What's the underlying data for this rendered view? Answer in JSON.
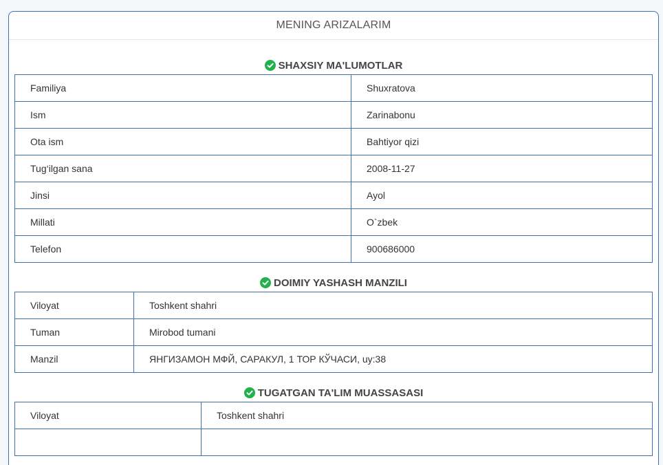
{
  "page": {
    "title": "MENING ARIZALARIM"
  },
  "sections": [
    {
      "title": "SHAXSIY MA'LUMOTLAR",
      "rows": [
        {
          "label": "Familiya",
          "value": "Shuxratova"
        },
        {
          "label": "Ism",
          "value": "Zarinabonu"
        },
        {
          "label": "Ota ism",
          "value": "Bahtiyor qizi"
        },
        {
          "label": "Tug‘ilgan sana",
          "value": "2008-11-27"
        },
        {
          "label": "Jinsi",
          "value": "Ayol"
        },
        {
          "label": "Millati",
          "value": "O`zbek"
        },
        {
          "label": "Telefon",
          "value": "900686000"
        }
      ]
    },
    {
      "title": "DOIMIY YASHASH MANZILI",
      "rows": [
        {
          "label": "Viloyat",
          "value": "Toshkent shahri"
        },
        {
          "label": "Tuman",
          "value": "Mirobod tumani"
        },
        {
          "label": "Manzil",
          "value": "ЯНГИЗАМОН МФЙ, САРАКУЛ, 1 ТОР КЎЧАСИ, uy:38"
        }
      ]
    },
    {
      "title": "TUGATGAN TA'LIM MUASSASASI",
      "rows": [
        {
          "label": "Viloyat",
          "value": "Toshkent shahri"
        },
        {
          "label": "",
          "value": ""
        }
      ]
    }
  ],
  "icons": {
    "section_status": "check-circle-icon"
  },
  "colors": {
    "accent_border": "#3b6fb3",
    "check_green": "#22b14c"
  }
}
